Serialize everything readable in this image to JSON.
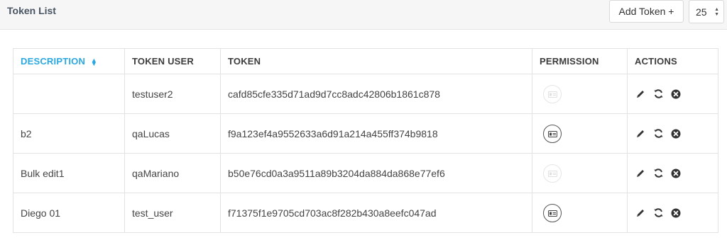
{
  "page": {
    "title": "Token List"
  },
  "toolbar": {
    "add_token_label": "Add Token +",
    "per_page_value": "25"
  },
  "table": {
    "columns": [
      "DESCRIPTION",
      "TOKEN USER",
      "TOKEN",
      "PERMISSION",
      "ACTIONS"
    ],
    "rows": [
      {
        "description": "",
        "user": "testuser2",
        "token": "cafd85cfe335d71ad9d7cc8adc42806b1861c878",
        "permission": "inactive"
      },
      {
        "description": "b2",
        "user": "qaLucas",
        "token": "f9a123ef4a9552633a6d91a214a455ff374b9818",
        "permission": "active"
      },
      {
        "description": "Bulk edit1",
        "user": "qaMariano",
        "token": "b50e76cd0a3a9511a89b3204da884da868e77ef6",
        "permission": "inactive"
      },
      {
        "description": "Diego 01",
        "user": "test_user",
        "token": "f71375f1e9705cd703ac8f282b430a8eefc047ad",
        "permission": "active"
      }
    ]
  },
  "icons": {
    "sort": "sort-icon",
    "permission": "id-card-icon",
    "edit": "pencil-icon",
    "regenerate": "refresh-icon",
    "delete": "close-circle-icon"
  },
  "colors": {
    "accent": "#2aa8e0",
    "header_bg": "#f6f6f6",
    "border": "#e3e3e3"
  }
}
